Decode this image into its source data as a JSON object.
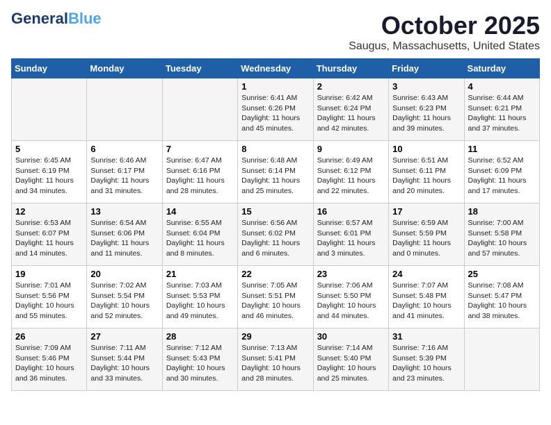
{
  "header": {
    "logo_line1a": "General",
    "logo_line1b": "Blue",
    "month": "October 2025",
    "location": "Saugus, Massachusetts, United States"
  },
  "days_of_week": [
    "Sunday",
    "Monday",
    "Tuesday",
    "Wednesday",
    "Thursday",
    "Friday",
    "Saturday"
  ],
  "weeks": [
    [
      {
        "day": "",
        "info": ""
      },
      {
        "day": "",
        "info": ""
      },
      {
        "day": "",
        "info": ""
      },
      {
        "day": "1",
        "info": "Sunrise: 6:41 AM\nSunset: 6:26 PM\nDaylight: 11 hours and 45 minutes."
      },
      {
        "day": "2",
        "info": "Sunrise: 6:42 AM\nSunset: 6:24 PM\nDaylight: 11 hours and 42 minutes."
      },
      {
        "day": "3",
        "info": "Sunrise: 6:43 AM\nSunset: 6:23 PM\nDaylight: 11 hours and 39 minutes."
      },
      {
        "day": "4",
        "info": "Sunrise: 6:44 AM\nSunset: 6:21 PM\nDaylight: 11 hours and 37 minutes."
      }
    ],
    [
      {
        "day": "5",
        "info": "Sunrise: 6:45 AM\nSunset: 6:19 PM\nDaylight: 11 hours and 34 minutes."
      },
      {
        "day": "6",
        "info": "Sunrise: 6:46 AM\nSunset: 6:17 PM\nDaylight: 11 hours and 31 minutes."
      },
      {
        "day": "7",
        "info": "Sunrise: 6:47 AM\nSunset: 6:16 PM\nDaylight: 11 hours and 28 minutes."
      },
      {
        "day": "8",
        "info": "Sunrise: 6:48 AM\nSunset: 6:14 PM\nDaylight: 11 hours and 25 minutes."
      },
      {
        "day": "9",
        "info": "Sunrise: 6:49 AM\nSunset: 6:12 PM\nDaylight: 11 hours and 22 minutes."
      },
      {
        "day": "10",
        "info": "Sunrise: 6:51 AM\nSunset: 6:11 PM\nDaylight: 11 hours and 20 minutes."
      },
      {
        "day": "11",
        "info": "Sunrise: 6:52 AM\nSunset: 6:09 PM\nDaylight: 11 hours and 17 minutes."
      }
    ],
    [
      {
        "day": "12",
        "info": "Sunrise: 6:53 AM\nSunset: 6:07 PM\nDaylight: 11 hours and 14 minutes."
      },
      {
        "day": "13",
        "info": "Sunrise: 6:54 AM\nSunset: 6:06 PM\nDaylight: 11 hours and 11 minutes."
      },
      {
        "day": "14",
        "info": "Sunrise: 6:55 AM\nSunset: 6:04 PM\nDaylight: 11 hours and 8 minutes."
      },
      {
        "day": "15",
        "info": "Sunrise: 6:56 AM\nSunset: 6:02 PM\nDaylight: 11 hours and 6 minutes."
      },
      {
        "day": "16",
        "info": "Sunrise: 6:57 AM\nSunset: 6:01 PM\nDaylight: 11 hours and 3 minutes."
      },
      {
        "day": "17",
        "info": "Sunrise: 6:59 AM\nSunset: 5:59 PM\nDaylight: 11 hours and 0 minutes."
      },
      {
        "day": "18",
        "info": "Sunrise: 7:00 AM\nSunset: 5:58 PM\nDaylight: 10 hours and 57 minutes."
      }
    ],
    [
      {
        "day": "19",
        "info": "Sunrise: 7:01 AM\nSunset: 5:56 PM\nDaylight: 10 hours and 55 minutes."
      },
      {
        "day": "20",
        "info": "Sunrise: 7:02 AM\nSunset: 5:54 PM\nDaylight: 10 hours and 52 minutes."
      },
      {
        "day": "21",
        "info": "Sunrise: 7:03 AM\nSunset: 5:53 PM\nDaylight: 10 hours and 49 minutes."
      },
      {
        "day": "22",
        "info": "Sunrise: 7:05 AM\nSunset: 5:51 PM\nDaylight: 10 hours and 46 minutes."
      },
      {
        "day": "23",
        "info": "Sunrise: 7:06 AM\nSunset: 5:50 PM\nDaylight: 10 hours and 44 minutes."
      },
      {
        "day": "24",
        "info": "Sunrise: 7:07 AM\nSunset: 5:48 PM\nDaylight: 10 hours and 41 minutes."
      },
      {
        "day": "25",
        "info": "Sunrise: 7:08 AM\nSunset: 5:47 PM\nDaylight: 10 hours and 38 minutes."
      }
    ],
    [
      {
        "day": "26",
        "info": "Sunrise: 7:09 AM\nSunset: 5:46 PM\nDaylight: 10 hours and 36 minutes."
      },
      {
        "day": "27",
        "info": "Sunrise: 7:11 AM\nSunset: 5:44 PM\nDaylight: 10 hours and 33 minutes."
      },
      {
        "day": "28",
        "info": "Sunrise: 7:12 AM\nSunset: 5:43 PM\nDaylight: 10 hours and 30 minutes."
      },
      {
        "day": "29",
        "info": "Sunrise: 7:13 AM\nSunset: 5:41 PM\nDaylight: 10 hours and 28 minutes."
      },
      {
        "day": "30",
        "info": "Sunrise: 7:14 AM\nSunset: 5:40 PM\nDaylight: 10 hours and 25 minutes."
      },
      {
        "day": "31",
        "info": "Sunrise: 7:16 AM\nSunset: 5:39 PM\nDaylight: 10 hours and 23 minutes."
      },
      {
        "day": "",
        "info": ""
      }
    ]
  ]
}
